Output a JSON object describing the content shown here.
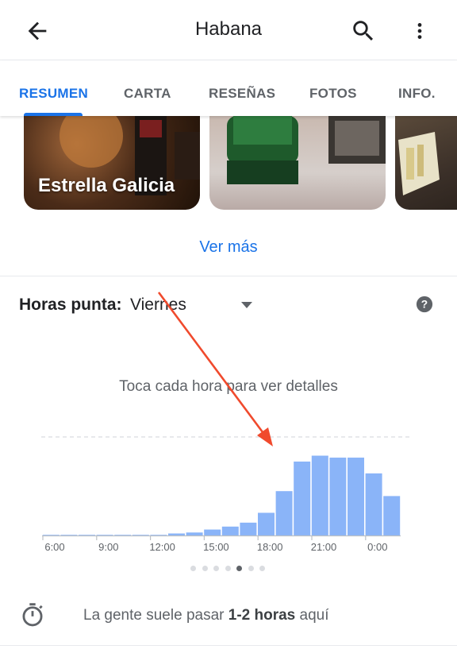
{
  "header": {
    "title": "Habana",
    "back_icon": "arrow-back-icon",
    "search_icon": "search-icon",
    "more_icon": "more-vert-icon"
  },
  "tabs": [
    {
      "label": "RESUMEN",
      "active": true
    },
    {
      "label": "CARTA",
      "active": false
    },
    {
      "label": "RESEÑAS",
      "active": false
    },
    {
      "label": "FOTOS",
      "active": false
    },
    {
      "label": "INFO.",
      "active": false
    }
  ],
  "photos": [
    {
      "caption": "Estrella Galicia"
    },
    {
      "caption": ""
    },
    {
      "caption": ""
    }
  ],
  "see_more": "Ver más",
  "popular_times": {
    "label": "Horas punta:",
    "day": "Viernes",
    "hint": "Toca cada hora para ver detalles",
    "page_count": 7,
    "active_page": 4
  },
  "chart_data": {
    "type": "bar",
    "x_ticks": [
      "6:00",
      "9:00",
      "12:00",
      "15:00",
      "18:00",
      "21:00",
      "0:00"
    ],
    "hours": [
      "6",
      "7",
      "8",
      "9",
      "10",
      "11",
      "12",
      "13",
      "14",
      "15",
      "16",
      "17",
      "18",
      "19",
      "20",
      "21",
      "22",
      "23",
      "0",
      "1"
    ],
    "values": [
      0,
      0,
      0,
      0,
      0,
      0,
      0,
      2,
      3,
      6,
      9,
      13,
      23,
      45,
      75,
      81,
      79,
      79,
      63,
      40
    ],
    "ylim": [
      0,
      100
    ],
    "reference_line": 100,
    "bar_color": "#8ab4f8"
  },
  "visit": {
    "icon": "timer-icon",
    "prefix": "La gente suele pasar",
    "duration": "1-2 horas",
    "suffix": "aquí"
  },
  "colors": {
    "accent": "#1a73e8",
    "annotation_arrow": "#f04a2d"
  }
}
